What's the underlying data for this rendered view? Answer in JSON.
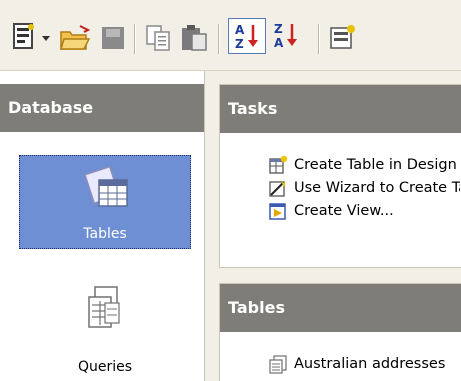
{
  "toolbar": {
    "buttons": [
      "new-document-icon",
      "dropdown-arrow-icon",
      "open-folder-icon",
      "save-icon",
      "copy-icon",
      "paste-icon",
      "sort-ascending-icon",
      "sort-descending-icon",
      "form-icon"
    ],
    "sort_ascending": {
      "top": "A",
      "bottom": "Z"
    },
    "sort_descending": {
      "top": "Z",
      "bottom": "A"
    }
  },
  "database_panel": {
    "title": "Database",
    "items": [
      {
        "label": "Tables",
        "icon": "tables-icon",
        "selected": true
      },
      {
        "label": "Queries",
        "icon": "queries-icon",
        "selected": false
      }
    ]
  },
  "tasks_panel": {
    "title": "Tasks",
    "items": [
      {
        "label": "Create Table in Design View...",
        "icon": "create-table-icon"
      },
      {
        "label": "Use Wizard to Create Table...",
        "icon": "wizard-icon"
      },
      {
        "label": "Create View...",
        "icon": "create-view-icon"
      }
    ]
  },
  "tables_panel": {
    "title": "Tables",
    "items": [
      {
        "label": "Australian addresses",
        "icon": "table-icon"
      }
    ]
  },
  "colors": {
    "header_bg": "#7e7d77",
    "selection_bg": "#6e8fd3",
    "toolbar_bg": "#f1efe6",
    "sort_red": "#cc2222",
    "sort_blue": "#1c3c9a"
  }
}
